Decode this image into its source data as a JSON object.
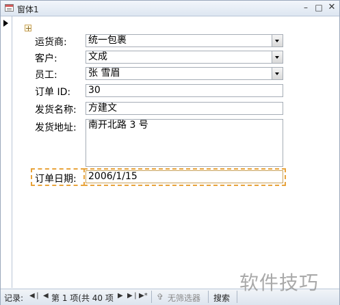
{
  "window": {
    "title": "窗体1"
  },
  "form": {
    "fields": [
      {
        "label": "运货商:",
        "value": "统一包裹"
      },
      {
        "label": "客户:",
        "value": "文成"
      },
      {
        "label": "员工:",
        "value": "张 雪眉"
      },
      {
        "label": "订单 ID:",
        "value": "30"
      },
      {
        "label": "发货名称:",
        "value": "方建文"
      },
      {
        "label": "发货地址:",
        "value": "南开北路 3 号"
      },
      {
        "label": "订单日期:",
        "value": "2006/1/15"
      }
    ]
  },
  "status_bar": {
    "record_label": "记录:",
    "record_position": "第 1 项(共 40 项",
    "filter_label": "无筛选器",
    "search_label": "搜索"
  },
  "watermark": {
    "text": "软件技巧"
  },
  "colors": {
    "selection": "#e8a33a",
    "titlebar": "#dde6f1"
  },
  "icons": [
    "form-icon",
    "minimize-icon",
    "restore-icon",
    "close-icon",
    "record-selector-icon",
    "form-selector-icon",
    "dropdown-icon",
    "filter-icon"
  ]
}
